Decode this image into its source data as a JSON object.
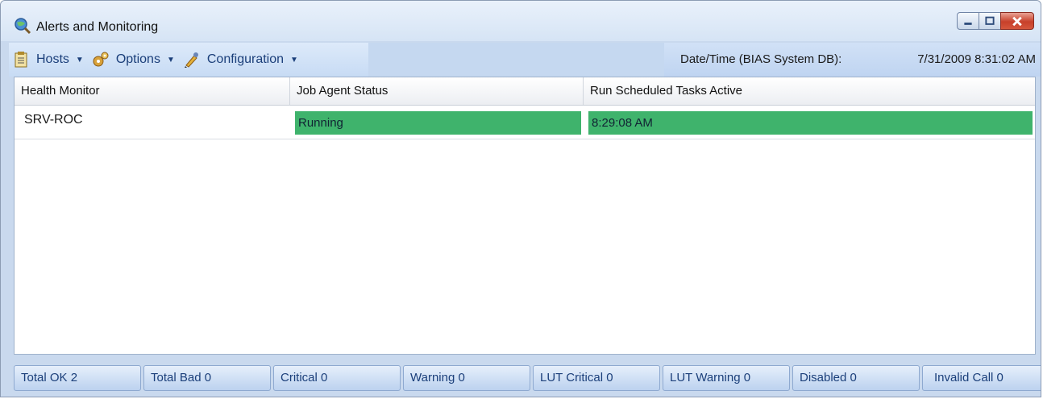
{
  "window": {
    "title": "Alerts and Monitoring",
    "icon": "globe-magnifier-icon"
  },
  "toolbar": {
    "items": [
      {
        "label": "Hosts",
        "icon": "clipboard-icon"
      },
      {
        "label": "Options",
        "icon": "gears-icon"
      },
      {
        "label": "Configuration",
        "icon": "wrench-pencil-icon"
      }
    ],
    "datetime_label": "Date/Time (BIAS System DB):",
    "datetime_value": "7/31/2009 8:31:02 AM"
  },
  "grid": {
    "columns": [
      "Health Monitor",
      "Job Agent Status",
      "Run Scheduled Tasks Active"
    ],
    "rows": [
      {
        "host": "SRV-ROC",
        "job_agent_status": "Running",
        "run_scheduled_tasks_active": "8:29:08 AM"
      }
    ],
    "status_color": "#3fb36c"
  },
  "statusbar": {
    "items": [
      "Total OK 2",
      "Total Bad 0",
      "Critical 0",
      "Warning 0",
      "LUT Critical 0",
      "LUT Warning 0",
      "Disabled 0",
      "Invalid Call 0"
    ]
  }
}
